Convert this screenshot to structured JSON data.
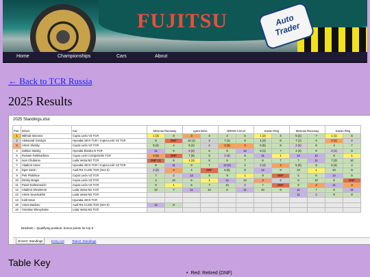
{
  "banner": {
    "logo_text": "FUJITSU",
    "sponsor_line1": "Auto",
    "sponsor_line2": "Trader"
  },
  "nav": {
    "items": [
      "Home",
      "Championships",
      "Cars",
      "About"
    ]
  },
  "back_link": "← Back to TCR Russia",
  "page_title": "2025 Results",
  "sheet": {
    "file_name": "2025 Standings.xlsx",
    "headers": {
      "pos": "Pos.",
      "driver": "Driver",
      "car": "Car"
    },
    "rounds": [
      "Moscow Raceway",
      "Igora Drive",
      "NRING Circuit",
      "Kazan Ring",
      "Moscow Raceway",
      "Kazan Ring"
    ],
    "rows": [
      {
        "pos": "1",
        "driver": "Mikhail Simonov",
        "car": "Cupra León VZ TCR",
        "cells": [
          "1 (3)",
          "8",
          "3",
          "4",
          "4",
          "5",
          "1 (2)",
          "4",
          "5 (2)",
          "7",
          "1 (1)",
          "6"
        ]
      },
      {
        "pos": "2",
        "driver": "Aleksandr Smolyar",
        "car": "Hyundai i30 N TCR / Cupra León VZ TCR",
        "cells": [
          "6",
          "DNF",
          "10 (1)",
          "2",
          "7 (1)",
          "6",
          "4 (3)",
          "8",
          "7 (1)",
          "4",
          "3 (2)",
          "2"
        ]
      },
      {
        "pos": "3",
        "driver": "Artem Slutsky",
        "car": "Cupra León VZ TCR",
        "cells": [
          "5 (4)",
          "4",
          "8 (4)",
          "2",
          "3 (3)",
          "3",
          "5 (5)",
          "8",
          "2 (4)",
          "5",
          "4",
          "7"
        ]
      },
      {
        "pos": "4",
        "driver": "Zakhar Slutsky",
        "car": "Hyundai Elantra N TCR",
        "cells": [
          "11",
          "5",
          "2 (2)",
          "6",
          "8",
          "12",
          "8 (1)",
          "7",
          "4 (3)",
          "8",
          "2 (1)",
          "8"
        ]
      },
      {
        "pos": "5",
        "driver": "Rustam Fatkhutdinov",
        "car": "Cupra León Competición TCR",
        "cells": [
          "3 (5)",
          "DNF",
          "7 (5)",
          "5",
          "2 (4)",
          "9",
          "11",
          "1",
          "12",
          "12",
          "8",
          "1"
        ]
      },
      {
        "pos": "6",
        "driver": "Ivan Chubarov",
        "car": "Lada Vesta NG TCR",
        "cells": [
          "DNF (1)",
          "6",
          "1 (3)",
          "8",
          "5",
          "7",
          "6",
          "7",
          "7",
          "11",
          "7 (3)",
          "10"
        ]
      },
      {
        "pos": "7",
        "driver": "Vladimir Atoev",
        "car": "Hyundai i30 N TCR / Cupra León VZ TCR",
        "cells": [
          "8",
          "11",
          "9",
          "7",
          "12 (2)",
          "4",
          "2 (4)",
          "3",
          "6 (5)",
          "9",
          "6 (4)",
          "4"
        ]
      },
      {
        "pos": "8",
        "driver": "Egor Sanin",
        "car": "Audi RS 3 LMS TCR (Gen II)",
        "cells": [
          "2 (2)",
          "3",
          "4",
          "DNF",
          "5 (5)",
          "8",
          "12",
          "9",
          "10",
          "1",
          "10",
          "9"
        ]
      },
      {
        "pos": "9",
        "driver": "Petr Plotnikov",
        "car": "Cupra León VZ TCR",
        "cells": [
          "7",
          "2",
          "12",
          "9",
          "9",
          "1",
          "9",
          "DNF",
          "5",
          "6",
          "12",
          "5"
        ]
      },
      {
        "pos": "10",
        "driver": "Dmitry Bragin",
        "car": "Cupra León VZ TCR",
        "cells": [
          "4",
          "10",
          "6",
          "1",
          "11",
          "10",
          "3",
          "2",
          "8",
          "10",
          "6",
          "DNF"
        ]
      },
      {
        "pos": "11",
        "driver": "Pavel Kalmanovich",
        "car": "Cupra León VZ TCR",
        "cells": [
          "9",
          "1",
          "5",
          "7",
          "10",
          "2",
          "7",
          "DNF",
          "9",
          "3",
          "11",
          "3"
        ]
      },
      {
        "pos": "12",
        "driver": "Vladimir Sheshenin",
        "car": "Lada Vesta NG TCR",
        "cells": [
          "10",
          "7",
          "11",
          "10",
          "6",
          "11",
          "10",
          "6",
          "11",
          "7",
          "9",
          "11"
        ]
      },
      {
        "pos": "13",
        "driver": "Artem Severiukhin",
        "car": "Lada Vesta NG TCR",
        "cells": [
          "",
          "",
          "",
          "",
          "",
          "",
          "",
          "",
          "11",
          "2",
          "9",
          "8"
        ]
      },
      {
        "pos": "14",
        "driver": "Kirill Smal",
        "car": "Hyundai i30 N TCR",
        "cells": [
          "",
          "",
          "",
          "",
          "",
          "",
          "",
          "",
          "",
          "",
          "",
          ""
        ]
      },
      {
        "pos": "15",
        "driver": "Anton Badoev",
        "car": "Audi RS 3 LMS TCR (Gen II)",
        "cells": [
          "12",
          "9",
          "",
          "",
          "",
          "",
          "",
          "",
          "",
          "",
          "",
          ""
        ]
      },
      {
        "pos": "16",
        "driver": "Yaroslav Shevyrtalov",
        "car": "Lada Vesta NG TCR",
        "cells": [
          "",
          "",
          "",
          "",
          "",
          "",
          "",
          "",
          "",
          "",
          "",
          ""
        ]
      }
    ],
    "note": "Brackets = Qualifying position; bonus points for top 5",
    "tabs": [
      "Drivers' Standings",
      "Entry List",
      "Teams' Standings"
    ]
  },
  "key": {
    "title": "Table Key",
    "item": "Red: Retired (DNF)"
  },
  "colors": {
    "page_bg": "#c8a2e0",
    "nav_bg": "#1f1a34",
    "link": "#1a1aff",
    "dnf": "#e06d4b",
    "win": "#fff26e",
    "points": "#c6e0b4"
  }
}
